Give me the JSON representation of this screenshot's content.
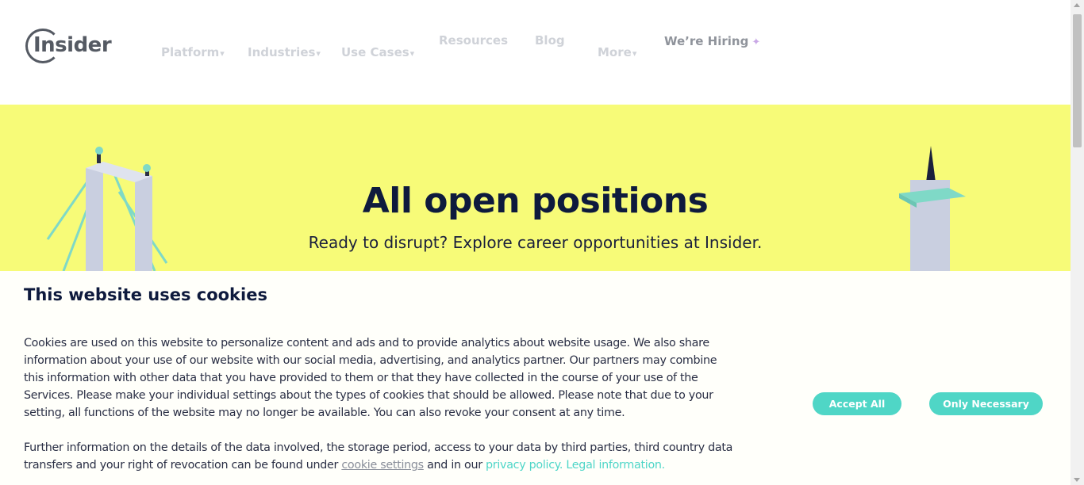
{
  "header": {
    "logo_text": "Insider",
    "nav": [
      {
        "label": "Platform",
        "caret": "▾"
      },
      {
        "label": "Industries",
        "caret": "▾"
      },
      {
        "label": "Use Cases",
        "caret": "▾"
      },
      {
        "label": "Resources"
      },
      {
        "label": "Blog"
      },
      {
        "label": "More",
        "caret": "▾"
      },
      {
        "label": "We’re Hiring"
      }
    ]
  },
  "hero": {
    "title": "All open positions",
    "subtitle": "Ready to disrupt? Explore career opportunities at Insider.",
    "background": "#f7fb78"
  },
  "cookie": {
    "title": "This website uses cookies",
    "paragraph1": "Cookies are used on this website to personalize content and ads and to provide analytics about website usage. We also share information about your use of our website with our social media, advertising, and analytics partner. Our partners may combine this information with other data that you have provided to them or that they have collected in the course of your use of the Services. Please make your individual settings about the types of cookies that should be allowed. Please note that due to your setting, all functions of the website may no longer be available. You can also revoke your consent at any time.",
    "paragraph2_prefix": "Further information on the details of the data involved, the storage period, access to your data by third parties, third country data transfers and your right of revocation can be found under ",
    "cookie_settings_link": "cookie settings",
    "paragraph2_middle": " and in our ",
    "privacy_link": "privacy policy.",
    "legal_link": " Legal information.",
    "accept_all": "Accept All",
    "only_necessary": "Only Necessary",
    "accent": "#4fd6c6"
  }
}
